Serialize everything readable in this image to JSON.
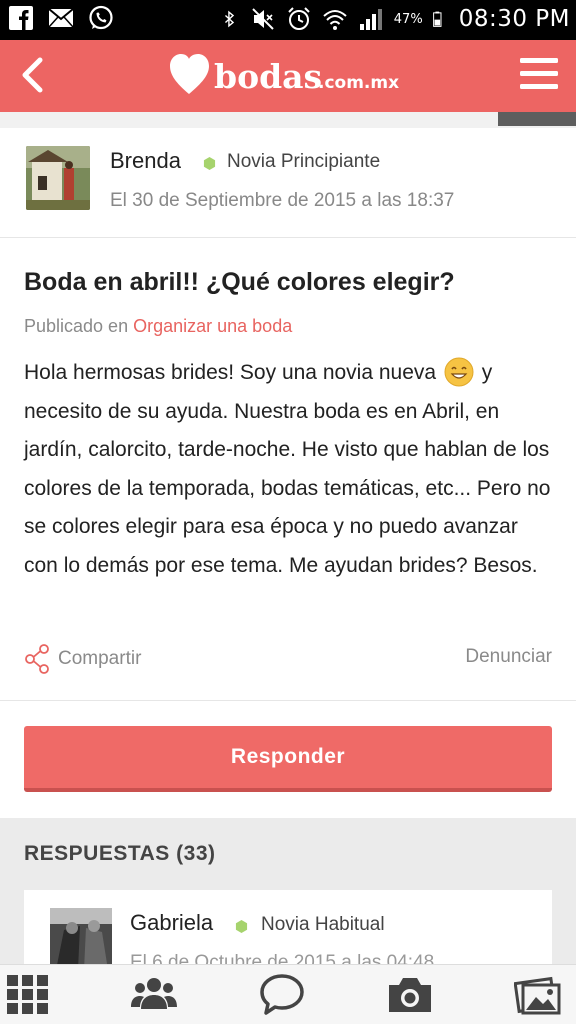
{
  "status_bar": {
    "left_icons": [
      "facebook-icon",
      "mail-icon",
      "whatsapp-icon"
    ],
    "right_icons": [
      "bluetooth-icon",
      "mute-icon",
      "alarm-icon",
      "wifi-icon",
      "signal-icon",
      "battery-icon"
    ],
    "battery": "47%",
    "time": "08:30 PM"
  },
  "header": {
    "logo_text": "bodas",
    "logo_domain": ".com.mx",
    "accent_color": "#ed6563"
  },
  "post": {
    "author": "Brenda",
    "rank": "Novia Principiante",
    "date": "El 30 de Septiembre de 2015 a las 18:37",
    "title": "Boda en abril!! ¿Qué colores elegir?",
    "published_prefix": "Publicado en",
    "category": "Organizar una boda",
    "body_part1": "Hola hermosas brides! Soy una novia nueva",
    "body_part2": "y necesito de su ayuda. Nuestra boda es en Abril, en jardín, calorcito, tarde-noche. He visto que hablan de los colores de la temporada, bodas temáticas, etc... Pero no se colores elegir para esa época y no puedo avanzar con lo demás por ese tema. Me ayudan brides? Besos.",
    "share_label": "Compartir",
    "report_label": "Denunciar"
  },
  "reply_button": "Responder",
  "responses": {
    "title": "RESPUESTAS (33)",
    "first": {
      "author": "Gabriela",
      "rank": "Novia Habitual",
      "date_partial": "El 6 de Octubre de 2015 a las 04:48"
    }
  },
  "bottom_nav": [
    "grid-icon",
    "community-icon",
    "chat-icon",
    "camera-icon",
    "photos-icon"
  ]
}
